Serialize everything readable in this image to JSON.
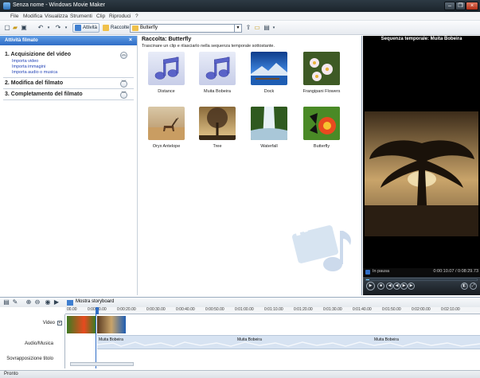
{
  "window": {
    "title": "Senza nome - Windows Movie Maker",
    "buttons": [
      "–",
      "❐",
      "×"
    ]
  },
  "menu": [
    "File",
    "Modifica",
    "Visualizza",
    "Strumenti",
    "Clip",
    "Riproduci",
    "?"
  ],
  "toolbar": {
    "tasks_label": "Attività",
    "collections_label": "Raccolte",
    "collection_value": "Butterfly"
  },
  "tasks": {
    "header": "Attività filmato",
    "sections": [
      {
        "title": "1. Acquisizione del video",
        "chevron": "︽",
        "links": [
          "Importa video",
          "Importa immagini",
          "Importa audio o musica"
        ]
      },
      {
        "title": "2. Modifica del filmato",
        "chevron": "︾",
        "links": []
      },
      {
        "title": "3. Completamento del filmato",
        "chevron": "︾",
        "links": []
      }
    ]
  },
  "collection": {
    "title": "Raccolta: Butterfly",
    "subtitle": "Trascinare un clip e rilasciarlo nella sequenza temporale sottostante.",
    "clips": [
      {
        "label": "Distance",
        "kind": "music"
      },
      {
        "label": "Muita Bobeira",
        "kind": "music"
      },
      {
        "label": "Dock",
        "kind": "dock"
      },
      {
        "label": "Frangipani Flowers",
        "kind": "flowers"
      },
      {
        "label": "Oryx Antelope",
        "kind": "oryx"
      },
      {
        "label": "Tree",
        "kind": "tree"
      },
      {
        "label": "Waterfall",
        "kind": "waterfall"
      },
      {
        "label": "Butterfly",
        "kind": "butterfly"
      }
    ]
  },
  "preview": {
    "title": "Sequenza temporale: Muita Bobeira",
    "status": "In pausa",
    "time": "0:00:10.07 / 0:08:29.73"
  },
  "timeline": {
    "storyboard_label": "Mostra storyboard",
    "ticks": [
      "00.00",
      "0:00:10.00",
      "0:00:20.00",
      "0:00:30.00",
      "0:00:40.00",
      "0:00:50.00",
      "0:01:00.00",
      "0:01:10.00",
      "0:01:20.00",
      "0:01:30.00",
      "0:01:40.00",
      "0:01:50.00",
      "0:02:00.00",
      "0:02:10.00"
    ],
    "tracks": {
      "video": "Video",
      "audio": "Audio/Musica",
      "title": "Sovrapposizione titolo"
    },
    "audio_clips": [
      "Muita Bobeira",
      "Muita Bobeira",
      "Muita Bobeira"
    ]
  },
  "status_bar": "Pronto",
  "colors": {
    "accent": "#2f6dc6",
    "preview_bg": "#000000",
    "link": "#2142b5"
  }
}
